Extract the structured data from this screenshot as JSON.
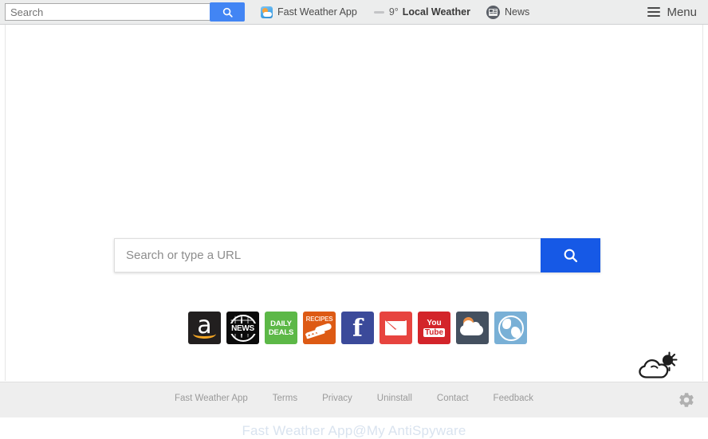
{
  "topbar": {
    "search_placeholder": "Search",
    "search_value": "",
    "search_button_icon": "search-icon",
    "app_link": {
      "label": "Fast Weather App",
      "icon": "fast-weather-app-icon"
    },
    "weather": {
      "icon": "cloud-icon",
      "temperature": "9°",
      "label": "Local Weather"
    },
    "news": {
      "label": "News",
      "icon": "newspaper-icon"
    },
    "menu": {
      "label": "Menu",
      "icon": "hamburger-icon"
    }
  },
  "main": {
    "search_placeholder": "Search or type a URL",
    "search_value": "",
    "search_button_icon": "search-icon",
    "accent_color": "#1659e6",
    "shortcuts": [
      {
        "name": "amazon",
        "label": "a",
        "color": "#221f1f"
      },
      {
        "name": "news",
        "label": "NEWS",
        "color": "#0b0b0b"
      },
      {
        "name": "deals",
        "label": "DAILY DEALS",
        "color": "#5cb847"
      },
      {
        "name": "recipes",
        "label": "RECIPES",
        "color": "#dd5a14"
      },
      {
        "name": "facebook",
        "label": "f",
        "color": "#3b4a9a"
      },
      {
        "name": "mail",
        "label": "Mail",
        "color": "#e7443f"
      },
      {
        "name": "youtube",
        "label": "You Tube",
        "color": "#d3242a"
      },
      {
        "name": "weather",
        "label": "Weather",
        "color": "#44505f"
      },
      {
        "name": "globe",
        "label": "Globe",
        "color": "#79b0d6"
      }
    ],
    "deals_line1": "DAILY",
    "deals_line2": "DEALS",
    "recipes_text": "RECIPES",
    "youtube_line1": "You",
    "youtube_line2": "Tube",
    "news_word": "NEWS",
    "weather_widget_icon": "sun-behind-cloud-icon",
    "watermark": "Fast Weather App@My AntiSpyware"
  },
  "footer": {
    "links": [
      "Fast Weather App",
      "Terms",
      "Privacy",
      "Uninstall",
      "Contact",
      "Feedback"
    ],
    "settings_icon": "gear-icon"
  }
}
